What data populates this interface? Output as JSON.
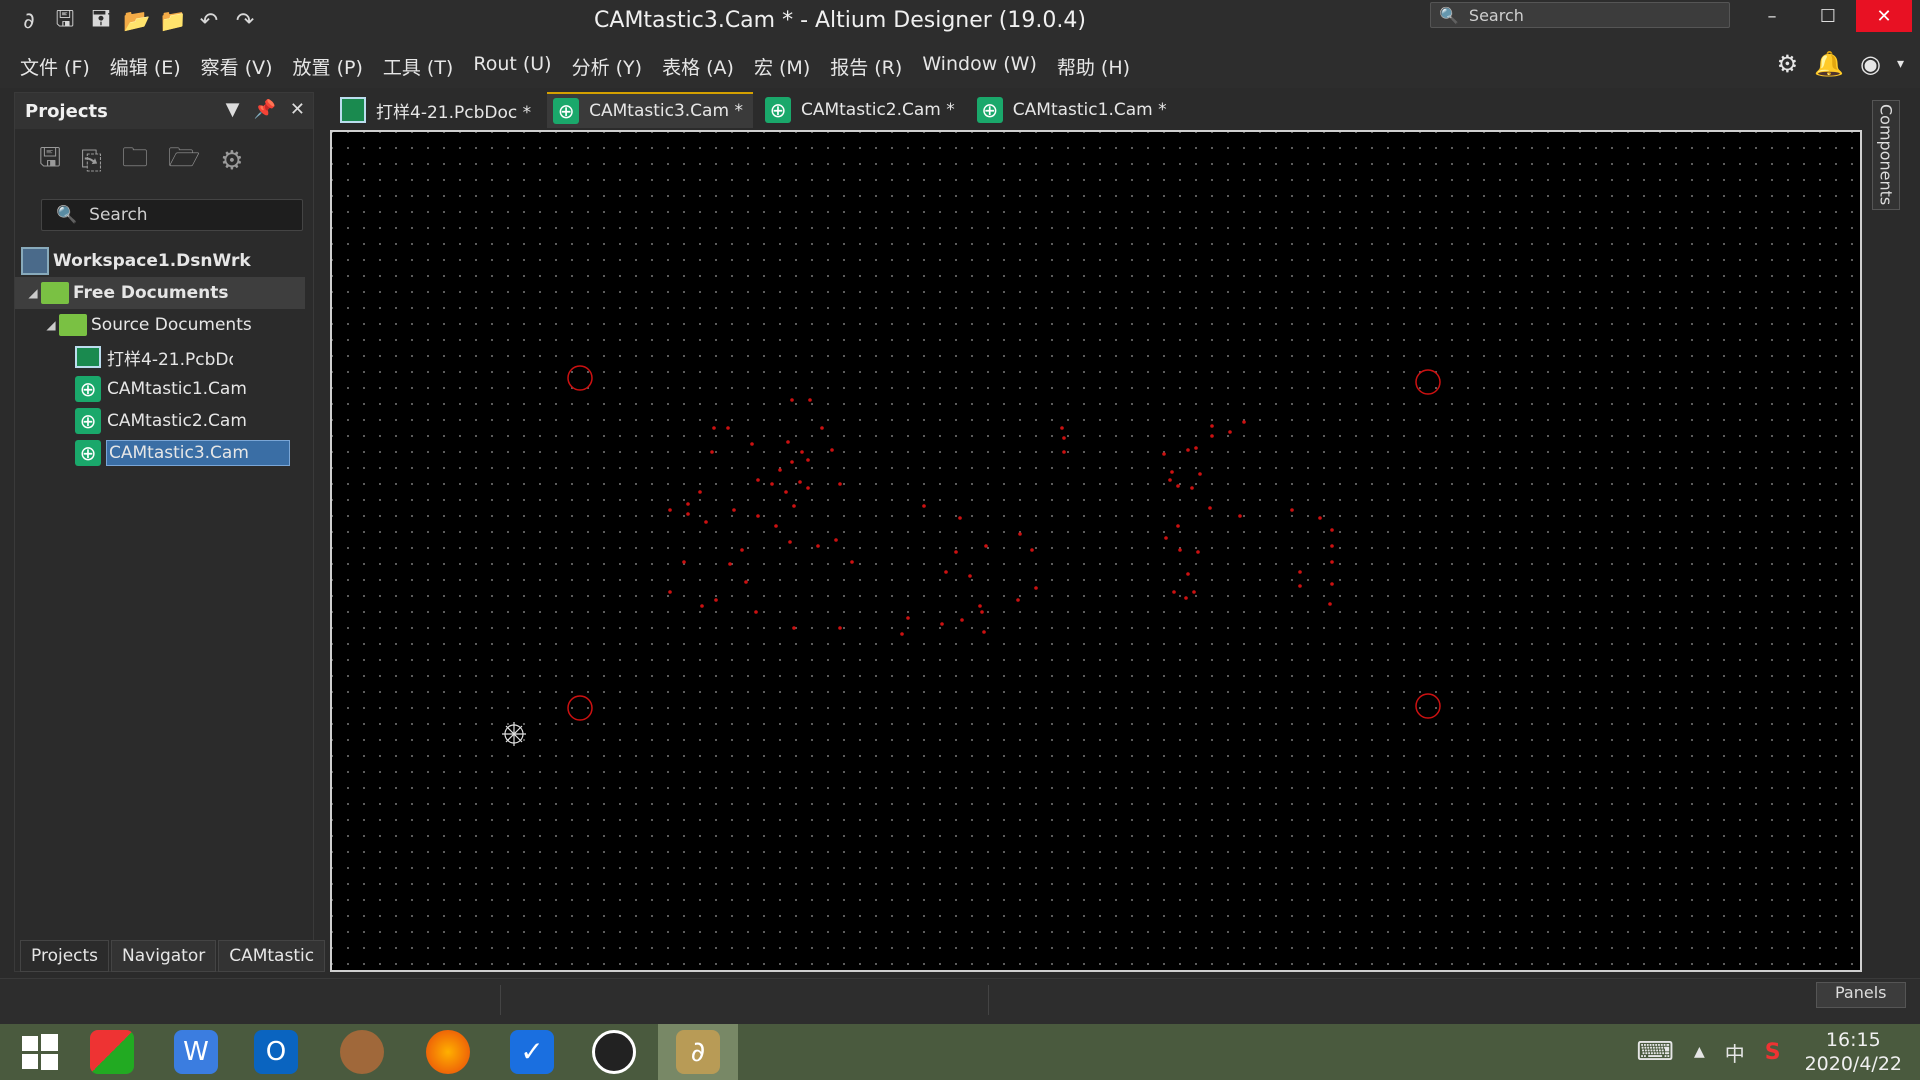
{
  "window": {
    "title": "CAMtastic3.Cam * - Altium Designer (19.0.4)",
    "search_placeholder": "Search",
    "minimize_glyph": "–",
    "maximize_glyph": "☐",
    "close_glyph": "✕"
  },
  "quick_access": [
    "app-logo-icon",
    "save-icon",
    "save-all-icon",
    "open-icon",
    "open-project-icon",
    "undo-icon",
    "redo-icon"
  ],
  "menu": {
    "items": [
      "文件 (F)",
      "编辑 (E)",
      "察看 (V)",
      "放置 (P)",
      "工具 (T)",
      "Rout (U)",
      "分析 (Y)",
      "表格 (A)",
      "宏 (M)",
      "报告 (R)",
      "Window (W)",
      "帮助 (H)"
    ]
  },
  "projects_panel": {
    "title": "Projects",
    "search_placeholder": "Search",
    "tree": {
      "workspace": "Workspace1.DsnWrk",
      "free_documents": "Free Documents",
      "source_documents": "Source Documents",
      "files": [
        "打样4-21.PcbDoc",
        "CAMtastic1.Cam",
        "CAMtastic2.Cam",
        "CAMtastic3.Cam"
      ]
    },
    "bottom_tabs": [
      "Projects",
      "Navigator",
      "CAMtastic"
    ]
  },
  "doc_tabs": [
    "打样4-21.PcbDoc *",
    "CAMtastic3.Cam *",
    "CAMtastic2.Cam *",
    "CAMtastic1.Cam *"
  ],
  "active_doc_tab": "CAMtastic3.Cam *",
  "right_panel": {
    "label": "Components"
  },
  "status": {
    "panels_button": "Panels"
  },
  "taskbar": {
    "clock_time": "16:15",
    "clock_date": "2020/4/22",
    "ime": "中",
    "apps": [
      "start-icon",
      "wps-app-icon",
      "wps-writer-icon",
      "outlook-icon",
      "bear-app-icon",
      "firefox-icon",
      "security-shield-icon",
      "qq-icon",
      "altium-icon"
    ]
  },
  "colors": {
    "canvas_bg": "#000000",
    "drill_red": "#cc1111",
    "selection": "#3a6ea5",
    "active_tab_accent": "#d4a000",
    "close_btn": "#e81123"
  }
}
